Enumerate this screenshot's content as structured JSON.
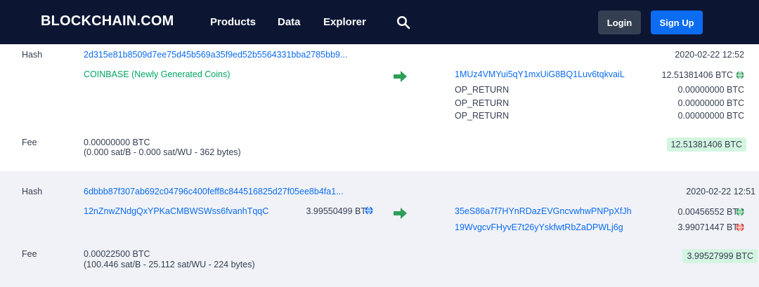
{
  "nav": {
    "logo": "BLOCKCHAIN.COM",
    "products": "Products",
    "data": "Data",
    "explorer": "Explorer",
    "search_icon": "search-icon",
    "login": "Login",
    "signup": "Sign Up"
  },
  "colors": {
    "navbar_bg": "#0C1633",
    "link": "#0C6CF2",
    "coinbase": "#00A663",
    "arrow": "#2E9E5B",
    "total_bg": "#D4F5E1",
    "globe_green": "#2E9E5B",
    "globe_red": "#E2493A"
  },
  "transactions": [
    {
      "hash_label": "Hash",
      "hash": "2d315e81b8509d7ee75d45b569a35f9ed52b5564331bba2785bb9...",
      "time": "2020-02-22 12:52",
      "input": "COINBASE (Newly Generated Coins)",
      "outputs": [
        {
          "address": "1MUz4VMYui5qY1mxUiG8BQ1Luv6tqkvaiL",
          "amount": "12.51381406 BTC",
          "icon": "globe-green"
        },
        {
          "address": "OP_RETURN",
          "amount": "0.00000000 BTC"
        },
        {
          "address": "OP_RETURN",
          "amount": "0.00000000 BTC"
        },
        {
          "address": "OP_RETURN",
          "amount": "0.00000000 BTC"
        }
      ],
      "fee_label": "Fee",
      "fee": "0.00000000 BTC",
      "fee_detail": "(0.000 sat/B - 0.000 sat/WU - 362 bytes)",
      "total": "12.51381406 BTC"
    },
    {
      "hash_label": "Hash",
      "hash": "6dbbb87f307ab692c04796c400feff8c844516825d27f05ee8b4fa1...",
      "time": "2020-02-22 12:51",
      "input_address": "12nZnwZNdgQxYPKaCMBWSWss6fvanhTqqC",
      "input_amount": "3.99550499 BTC",
      "input_icon": "globe-blue",
      "outputs": [
        {
          "address": "35eS86a7f7HYnRDazEVGncvwhwPNPpXfJh",
          "amount": "0.00456552 BTC",
          "icon": "globe-green"
        },
        {
          "address": "19WvgcvFHyvE7t26yYskfwtRbZaDPWLj6g",
          "amount": "3.99071447 BTC",
          "icon": "globe-red"
        }
      ],
      "fee_label": "Fee",
      "fee": "0.00022500 BTC",
      "fee_detail": "(100.446 sat/B - 25.112 sat/WU - 224 bytes)",
      "total": "3.99527999 BTC"
    }
  ]
}
